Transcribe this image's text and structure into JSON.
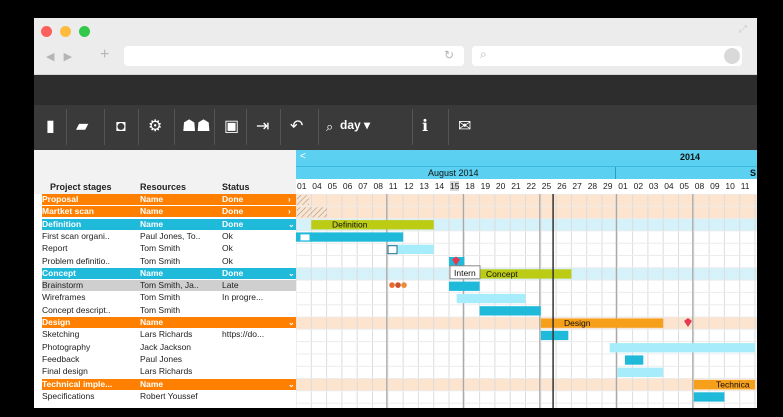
{
  "browser": {
    "nav_back": "◀",
    "nav_forward": "▶",
    "new_tab": "+",
    "reload_icon": "reload-icon",
    "search_icon": "search-icon"
  },
  "toolbar": {
    "zoom_label": "day",
    "icons": [
      "new-doc-icon",
      "open-folder-icon",
      "save-icon",
      "settings-icon",
      "users-icon",
      "print-icon",
      "export-icon",
      "undo-icon",
      "zoom-icon",
      "info-icon",
      "mail-icon"
    ]
  },
  "table": {
    "headers": [
      "Project stages",
      "Resources",
      "Status"
    ],
    "rows": [
      {
        "stage": "Proposal",
        "resources": "Name",
        "status": "Done",
        "type": "group",
        "color": "#ff8000",
        "arrow": "›"
      },
      {
        "stage": "Martket scan",
        "resources": "Name",
        "status": "Done",
        "type": "group",
        "color": "#ff8000",
        "arrow": "›"
      },
      {
        "stage": "Definition",
        "resources": "Name",
        "status": "Done",
        "type": "group",
        "color": "#1fb9da",
        "arrow": "⌄"
      },
      {
        "stage": "First scan organi..",
        "resources": "Paul Jones, To..",
        "status": "Ok",
        "type": "task"
      },
      {
        "stage": "Report",
        "resources": "Tom Smith",
        "status": "Ok",
        "type": "task"
      },
      {
        "stage": "Problem definitio..",
        "resources": "Tom Smith",
        "status": "Ok",
        "type": "task"
      },
      {
        "stage": "Concept",
        "resources": "Name",
        "status": "Done",
        "type": "group",
        "color": "#1fb9da",
        "arrow": "⌄"
      },
      {
        "stage": "Brainstorm",
        "resources": "Tom Smith, Ja..",
        "status": "Late",
        "type": "task",
        "highlight": true
      },
      {
        "stage": "Wireframes",
        "resources": "Tom Smith",
        "status": "In progre...",
        "type": "task"
      },
      {
        "stage": "Concept descript..",
        "resources": "Tom Smith",
        "status": "",
        "type": "task"
      },
      {
        "stage": "Design",
        "resources": "Name",
        "status": "",
        "type": "group",
        "color": "#ff8000",
        "arrow": "⌄"
      },
      {
        "stage": "Sketching",
        "resources": "Lars Richards",
        "status": "https://do...",
        "type": "task"
      },
      {
        "stage": "Photography",
        "resources": "Jack Jackson",
        "status": "",
        "type": "task"
      },
      {
        "stage": "Feedback",
        "resources": "Paul Jones",
        "status": "",
        "type": "task"
      },
      {
        "stage": "Final design",
        "resources": "Lars Richards",
        "status": "",
        "type": "task"
      },
      {
        "stage": "Technical imple...",
        "resources": "Name",
        "status": "",
        "type": "group",
        "color": "#ff8000",
        "arrow": "⌄"
      },
      {
        "stage": "Specifications",
        "resources": "Robert Youssef",
        "status": "",
        "type": "task"
      }
    ]
  },
  "timeline": {
    "year": "2014",
    "month": "August 2014",
    "next_month_initial": "S",
    "scroll_left": "<",
    "days": [
      "01",
      "04",
      "05",
      "06",
      "07",
      "08",
      "11",
      "12",
      "13",
      "14",
      "15",
      "18",
      "19",
      "20",
      "21",
      "22",
      "25",
      "26",
      "27",
      "28",
      "29",
      "01",
      "02",
      "03",
      "04",
      "05",
      "08",
      "09",
      "10",
      "11"
    ],
    "today_day": "15"
  },
  "gantt": {
    "labels": {
      "definition": "Definition",
      "concept": "Concept",
      "design": "Design",
      "technical": "Technica",
      "tooltip": "Intern"
    },
    "colors": {
      "orange": "#ff8000",
      "blue": "#1fb9da",
      "olive": "#bccb14",
      "light_blue": "#a7ecfa",
      "design_bar": "#f59f1a"
    }
  }
}
